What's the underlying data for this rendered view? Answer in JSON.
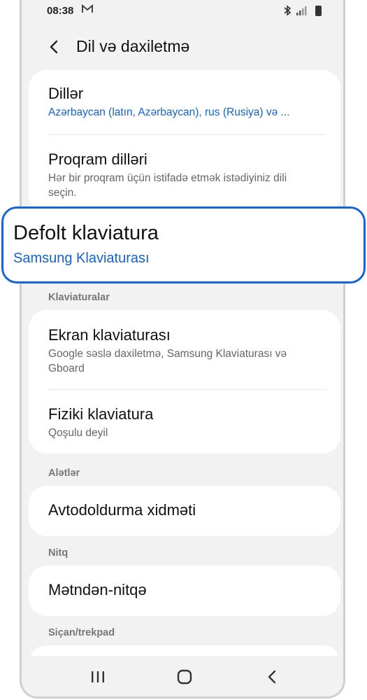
{
  "status": {
    "time": "08:38"
  },
  "header": {
    "title": "Dil və daxiletmə"
  },
  "items": {
    "languages": {
      "title": "Dillər",
      "subtitle": "Azərbaycan (latın, Azərbaycan), rus (Rusiya) və ..."
    },
    "app_languages": {
      "title": "Proqram dilləri",
      "subtitle": "Hər bir proqram üçün istifadə etmək istədiyiniz dili seçin."
    },
    "default_keyboard": {
      "title": "Defolt klaviatura",
      "subtitle": "Samsung Klaviaturası"
    },
    "onscreen_keyboard": {
      "title": "Ekran klaviaturası",
      "subtitle": "Google səslə daxiletmə, Samsung Klaviaturası və Gboard"
    },
    "physical_keyboard": {
      "title": "Fiziki klaviatura",
      "subtitle": "Qoşulu deyil"
    },
    "autofill": {
      "title": "Avtodoldurma xidməti"
    },
    "tts": {
      "title": "Mətndən-nitqə"
    }
  },
  "sections": {
    "keyboards": "Klaviaturalar",
    "tools": "Alətlər",
    "speech": "Nitq",
    "mouse": "Siçan/trekpad"
  },
  "colors": {
    "accent": "#1565d8",
    "link": "#1262d6",
    "background": "#f2f2f2"
  }
}
